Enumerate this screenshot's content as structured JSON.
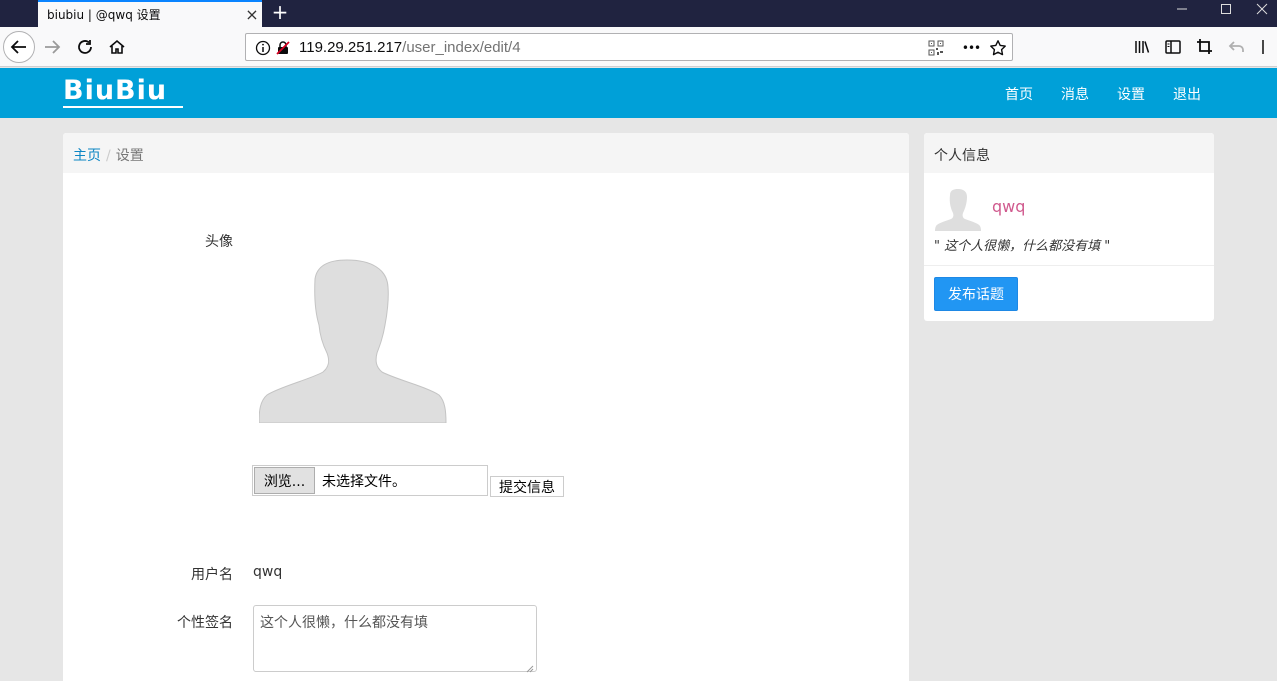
{
  "browser": {
    "tab_title": "biubiu | @qwq 设置",
    "tab_close": "×",
    "new_tab": "+",
    "url_host": "119.29.251.217",
    "url_path": "/user_index/edit/4",
    "page_actions": "•••"
  },
  "site": {
    "logo": "BiuBiu",
    "nav": {
      "home": "首页",
      "messages": "消息",
      "settings": "设置",
      "logout": "退出"
    }
  },
  "breadcrumb": {
    "home": "主页",
    "separator": "/",
    "current": "设置"
  },
  "form": {
    "avatar_label": "头像",
    "browse_button": "浏览...",
    "file_status": "未选择文件。",
    "submit_button": "提交信息",
    "username_label": "用户名",
    "username_value": "qwq",
    "signature_label": "个性签名",
    "signature_value": "这个人很懒，什么都没有填"
  },
  "sidebar": {
    "heading": "个人信息",
    "username": "qwq",
    "signature": "\" 这个人很懒，什么都没有填 \"",
    "publish_button": "发布话题"
  },
  "colors": {
    "site_nav": "#00a0d8",
    "publish_button": "#2196f3",
    "username_pink": "#d05a8e",
    "link_blue": "#0d86c4"
  }
}
